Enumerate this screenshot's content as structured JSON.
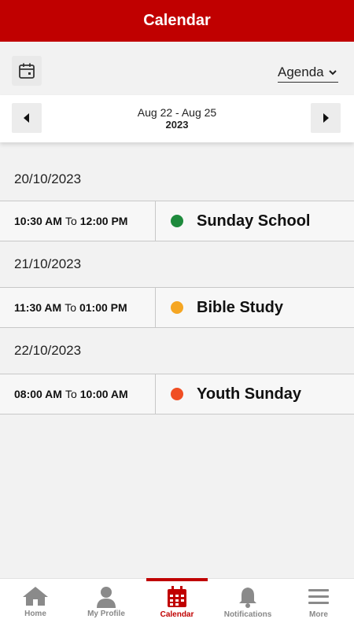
{
  "header": {
    "title": "Calendar"
  },
  "toolbar": {
    "calendar_icon": "calendar-icon",
    "view_select": {
      "value": "Agenda",
      "chevron_icon": "chevron-down-icon"
    }
  },
  "date_nav": {
    "range": "Aug 22 - Aug 25",
    "year": "2023",
    "prev_icon": "caret-left-icon",
    "next_icon": "caret-right-icon"
  },
  "agenda": {
    "days": [
      {
        "date": "20/10/2023",
        "event": {
          "start": "10:30 AM",
          "to": "To",
          "end": "12:00 PM",
          "title": "Sunday School",
          "color": "#1e8a3c"
        }
      },
      {
        "date": "21/10/2023",
        "event": {
          "start": "11:30 AM",
          "to": "To",
          "end": "01:00 PM",
          "title": "Bible Study",
          "color": "#f5a623"
        }
      },
      {
        "date": "22/10/2023",
        "event": {
          "start": "08:00 AM",
          "to": "To",
          "end": "10:00 AM",
          "title": "Youth Sunday",
          "color": "#f04e23"
        }
      }
    ]
  },
  "bottom_nav": {
    "tabs": [
      {
        "label": "Home",
        "icon": "home-icon"
      },
      {
        "label": "My Profile",
        "icon": "user-icon"
      },
      {
        "label": "Calendar",
        "icon": "calendar-icon",
        "active": true
      },
      {
        "label": "Notifications",
        "icon": "bell-icon"
      },
      {
        "label": "More",
        "icon": "menu-icon"
      }
    ]
  },
  "colors": {
    "brand": "#c00000",
    "inactive_tab": "#888888"
  }
}
